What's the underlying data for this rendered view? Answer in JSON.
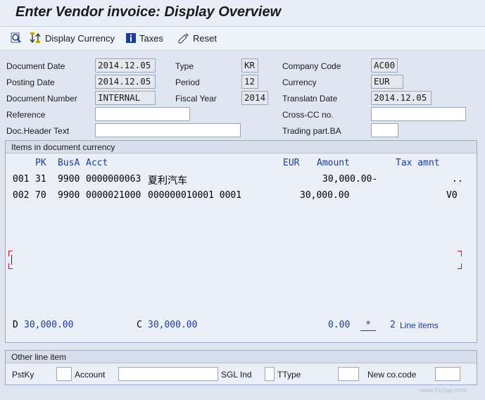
{
  "window": {
    "title": "Enter Vendor invoice: Display Overview"
  },
  "toolbar": {
    "display_currency_label": "Display Currency",
    "taxes_label": "Taxes",
    "reset_label": "Reset"
  },
  "header": {
    "document_date": {
      "label": "Document Date",
      "value": "2014.12.05"
    },
    "posting_date": {
      "label": "Posting Date",
      "value": "2014.12.05"
    },
    "document_number": {
      "label": "Document Number",
      "value": "INTERNAL"
    },
    "reference": {
      "label": "Reference",
      "value": ""
    },
    "doc_header_text": {
      "label": "Doc.Header Text",
      "value": ""
    },
    "type": {
      "label": "Type",
      "value": "KR"
    },
    "period": {
      "label": "Period",
      "value": "12"
    },
    "fiscal_year": {
      "label": "Fiscal Year",
      "value": "2014"
    },
    "company_code": {
      "label": "Company Code",
      "value": "AC00"
    },
    "currency": {
      "label": "Currency",
      "value": "EUR"
    },
    "translatn_date": {
      "label": "Translatn Date",
      "value": "2014.12.05"
    },
    "cross_cc_no": {
      "label": "Cross-CC no.",
      "value": ""
    },
    "trading_part_ba": {
      "label": "Trading part.BA",
      "value": ""
    }
  },
  "items": {
    "title": "Items in document currency",
    "columns": {
      "pk": "PK",
      "busa": "BusA",
      "acct": "Acct",
      "currency": "EUR",
      "amount": "Amount",
      "tax": "Tax amnt"
    },
    "rows": [
      {
        "line": "001",
        "pk": "31",
        "busa": "9900",
        "acct": "0000000063",
        "text": "夏利汽车",
        "amount": "30,000.00-",
        "tax": "..",
        "taxcode": ""
      },
      {
        "line": "002",
        "pk": "70",
        "busa": "9900",
        "acct": "0000021000",
        "text": "000000010001 0001",
        "amount": "30,000.00",
        "tax": "",
        "taxcode": "V0"
      }
    ],
    "totals": {
      "debit_label": "D",
      "debit_value": "30,000.00",
      "credit_label": "C",
      "credit_value": "30,000.00",
      "balance": "0.00",
      "balance_marker": "*",
      "line_items_count": "2",
      "line_items_label": "Line items"
    }
  },
  "other_line_item": {
    "title": "Other line item",
    "pstky_label": "PstKy",
    "account_label": "Account",
    "sgl_ind_label": "SGL Ind",
    "ttype_label": "TType",
    "new_cocode_label": "New co.code"
  },
  "watermark": {
    "site": "www.91Sap.com"
  }
}
